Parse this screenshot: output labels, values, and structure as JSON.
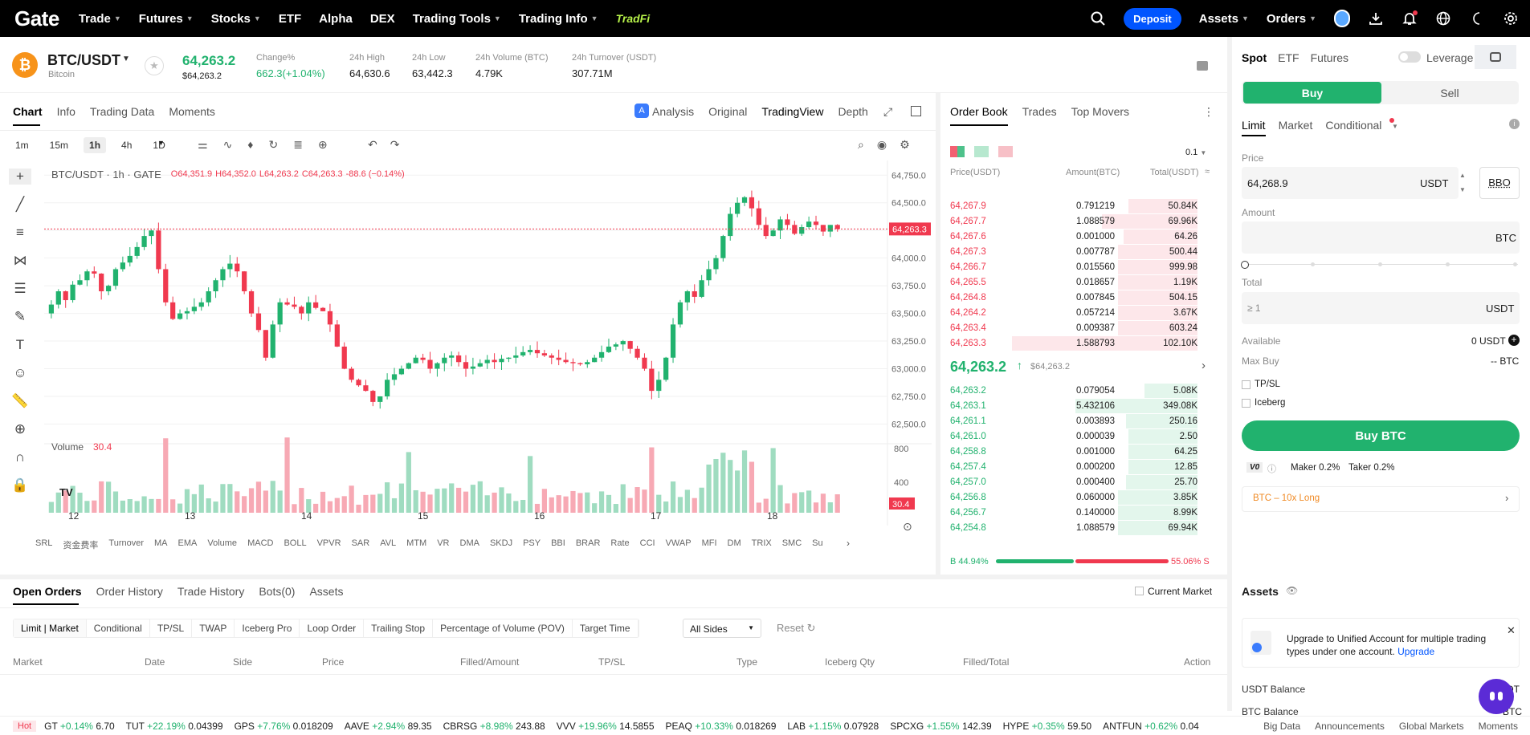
{
  "nav": {
    "logo": "Gate",
    "items": [
      "Trade",
      "Futures",
      "Stocks",
      "ETF",
      "Alpha",
      "DEX",
      "Trading Tools",
      "Trading Info"
    ],
    "tradfi": "TradFi",
    "deposit": "Deposit",
    "assets": "Assets",
    "orders": "Orders"
  },
  "pair": {
    "symbol": "BTC/USDT",
    "name": "Bitcoin",
    "price": "64,263.2",
    "price_usd": "$64,263.2",
    "stats": [
      {
        "label": "Change%",
        "value": "662.3(+1.04%)",
        "color": "green"
      },
      {
        "label": "24h High",
        "value": "64,630.6"
      },
      {
        "label": "24h Low",
        "value": "63,442.3"
      },
      {
        "label": "24h Volume (BTC)",
        "value": "4.79K"
      },
      {
        "label": "24h Turnover (USDT)",
        "value": "307.71M"
      }
    ]
  },
  "chart_tabs": [
    "Chart",
    "Info",
    "Trading Data",
    "Moments"
  ],
  "chart_views": [
    "Analysis",
    "Original",
    "TradingView",
    "Depth"
  ],
  "timeframes": [
    "1m",
    "15m",
    "1h",
    "4h",
    "1D"
  ],
  "chart_legend": {
    "title": "BTC/USDT · 1h · GATE",
    "o": "O64,351.9",
    "h": "H64,352.0",
    "l": "L64,263.2",
    "c": "C64,263.3",
    "chg": "-88.6 (−0.14%)"
  },
  "volume_label": "Volume",
  "volume_value": "30.4",
  "indicators": [
    "SRL",
    "资金费率",
    "Turnover",
    "MA",
    "EMA",
    "Volume",
    "MACD",
    "BOLL",
    "VPVR",
    "SAR",
    "AVL",
    "MTM",
    "VR",
    "DMA",
    "SKDJ",
    "PSY",
    "BBI",
    "BRAR",
    "Rate",
    "CCI",
    "VWAP",
    "MFI",
    "DM",
    "TRIX",
    "SMC",
    "Su"
  ],
  "chart_data": {
    "type": "candlestick",
    "y_ticks": [
      "64,750.0",
      "64,500.0",
      "64,250.0",
      "64,000.0",
      "63,750.0",
      "63,500.0",
      "63,250.0",
      "63,000.0",
      "62,750.0",
      "62,500.0"
    ],
    "ylim": [
      62380,
      64810
    ],
    "x_ticks": [
      "12",
      "13",
      "14",
      "15",
      "16",
      "17",
      "18"
    ],
    "last_price_tag": "64,263.3",
    "vol_ticks": [
      "800",
      "400"
    ],
    "vol_last_tag": "30.4",
    "price_path": [
      63500,
      63580,
      63700,
      63620,
      63760,
      63800,
      63880,
      63860,
      63700,
      63750,
      63900,
      63960,
      64020,
      64100,
      64200,
      64250,
      63900,
      63600,
      63450,
      63500,
      63520,
      63560,
      63600,
      63700,
      63800,
      63900,
      63950,
      63880,
      63700,
      63500,
      63350,
      63100,
      63400,
      63600,
      63580,
      63560,
      63500,
      63600,
      63550,
      63520,
      63400,
      63200,
      63000,
      62900,
      62850,
      62800,
      62700,
      62750,
      62900,
      62950,
      63000,
      63050,
      63100,
      63080,
      63000,
      63050,
      63100,
      63120,
      63060,
      63000,
      63020,
      63050,
      63080,
      63060,
      63090,
      63100,
      63120,
      63150,
      63170,
      63140,
      63120,
      63100,
      63080,
      63060,
      63050,
      63040,
      63060,
      63100,
      63150,
      63200,
      63220,
      63250,
      63180,
      63100,
      63000,
      62800,
      62900,
      63100,
      63400,
      63600,
      63700,
      63650,
      63800,
      63900,
      64000,
      64200,
      64400,
      64500,
      64550,
      64450,
      64300,
      64200,
      64250,
      64350,
      64300,
      64220,
      64280,
      64330,
      64300,
      64240,
      64300,
      64263
    ]
  },
  "orderbook": {
    "tabs": [
      "Order Book",
      "Trades",
      "Top Movers"
    ],
    "step": "0.1",
    "headers": [
      "Price(USDT)",
      "Amount(BTC)",
      "Total(USDT)"
    ],
    "asks": [
      [
        "64,267.9",
        "0.791219",
        "50.84K"
      ],
      [
        "64,267.7",
        "1.088579",
        "69.96K"
      ],
      [
        "64,267.6",
        "0.001000",
        "64.26"
      ],
      [
        "64,267.3",
        "0.007787",
        "500.44"
      ],
      [
        "64,266.7",
        "0.015560",
        "999.98"
      ],
      [
        "64,265.5",
        "0.018657",
        "1.19K"
      ],
      [
        "64,264.8",
        "0.007845",
        "504.15"
      ],
      [
        "64,264.2",
        "0.057214",
        "3.67K"
      ],
      [
        "64,263.4",
        "0.009387",
        "603.24"
      ],
      [
        "64,263.3",
        "1.588793",
        "102.10K"
      ]
    ],
    "ask_depth": [
      0.26,
      0.36,
      0.28,
      0.3,
      0.3,
      0.3,
      0.3,
      0.3,
      0.3,
      0.7
    ],
    "mid": "64,263.2",
    "mid_usd": "$64,263.2",
    "bids": [
      [
        "64,263.2",
        "0.079054",
        "5.08K"
      ],
      [
        "64,263.1",
        "5.432106",
        "349.08K"
      ],
      [
        "64,261.1",
        "0.003893",
        "250.16"
      ],
      [
        "64,261.0",
        "0.000039",
        "2.50"
      ],
      [
        "64,258.8",
        "0.001000",
        "64.25"
      ],
      [
        "64,257.4",
        "0.000200",
        "12.85"
      ],
      [
        "64,257.0",
        "0.000400",
        "25.70"
      ],
      [
        "64,256.8",
        "0.060000",
        "3.85K"
      ],
      [
        "64,256.7",
        "0.140000",
        "8.99K"
      ],
      [
        "64,254.8",
        "1.088579",
        "69.94K"
      ]
    ],
    "bid_depth": [
      0.2,
      0.46,
      0.27,
      0.26,
      0.26,
      0.26,
      0.27,
      0.3,
      0.3,
      0.3
    ],
    "buy_pct": "B 44.94%",
    "sell_pct": "55.06% S",
    "buy_ratio": 0.4494
  },
  "trade": {
    "tabs": [
      "Spot",
      "ETF",
      "Futures"
    ],
    "leverage": "Leverage",
    "buy": "Buy",
    "sell": "Sell",
    "order_types": [
      "Limit",
      "Market",
      "Conditional"
    ],
    "price_label": "Price",
    "price_value": "64,268.9",
    "price_unit": "USDT",
    "bbo": "BBO",
    "amount_label": "Amount",
    "amount_unit": "BTC",
    "total_label": "Total",
    "total_placeholder": "≥ 1",
    "total_unit": "USDT",
    "available_label": "Available",
    "available_value": "0 USDT",
    "maxbuy_label": "Max Buy",
    "maxbuy_value": "-- BTC",
    "tpsl": "TP/SL",
    "iceberg": "Iceberg",
    "buy_btn": "Buy BTC",
    "vip": "V0",
    "maker": "Maker 0.2%",
    "taker": "Taker 0.2%",
    "promo": "BTC – 10x Long"
  },
  "orders": {
    "tabs": [
      "Open Orders",
      "Order History",
      "Trade History",
      "Bots(0)",
      "Assets"
    ],
    "current_market": "Current Market",
    "subtabs": [
      "Limit | Market",
      "Conditional",
      "TP/SL",
      "TWAP",
      "Iceberg Pro",
      "Loop Order",
      "Trailing Stop",
      "Percentage of Volume (POV)",
      "Target Time"
    ],
    "sides": "All Sides",
    "reset": "Reset",
    "columns": [
      "Market",
      "Date",
      "Side",
      "Price",
      "Filled/Amount",
      "TP/SL",
      "Type",
      "Iceberg Qty",
      "Filled/Total",
      "Action"
    ]
  },
  "assets": {
    "title": "Assets",
    "upgrade_text": "Upgrade to Unified Account for multiple trading types under one account.",
    "upgrade_link": "Upgrade",
    "usdt_balance": "USDT Balance",
    "usdt_val": "DT",
    "btc_balance": "BTC Balance",
    "btc_val": "BTC"
  },
  "tickerbar": {
    "hot": "Hot",
    "items": [
      [
        "GT",
        "+0.14%",
        "6.70"
      ],
      [
        "TUT",
        "+22.19%",
        "0.04399"
      ],
      [
        "GPS",
        "+7.76%",
        "0.018209"
      ],
      [
        "AAVE",
        "+2.94%",
        "89.35"
      ],
      [
        "CBRSG",
        "+8.98%",
        "243.88"
      ],
      [
        "VVV",
        "+19.96%",
        "14.5855"
      ],
      [
        "PEAQ",
        "+10.33%",
        "0.018269"
      ],
      [
        "LAB",
        "+1.15%",
        "0.07928"
      ],
      [
        "SPCXG",
        "+1.55%",
        "142.39"
      ],
      [
        "HYPE",
        "+0.35%",
        "59.50"
      ],
      [
        "ANTFUN",
        "+0.62%",
        "0.04"
      ]
    ],
    "links": [
      "Big Data",
      "Announcements",
      "Global Markets",
      "Moments"
    ]
  }
}
